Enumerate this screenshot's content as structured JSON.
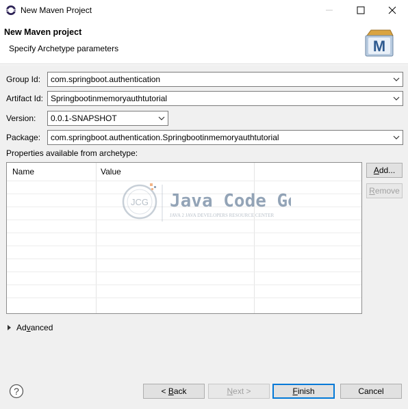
{
  "window": {
    "title": "New Maven Project"
  },
  "header": {
    "title": "New Maven project",
    "subtitle": "Specify Archetype parameters",
    "logo_letter": "M"
  },
  "form": {
    "group_id": {
      "label": "Group Id:",
      "value": "com.springboot.authentication"
    },
    "artifact_id": {
      "label": "Artifact Id:",
      "value": "Springbootinmemoryauthtutorial"
    },
    "version": {
      "label": "Version:",
      "value": "0.0.1-SNAPSHOT"
    },
    "package": {
      "label": "Package:",
      "value": "com.springboot.authentication.Springbootinmemoryauthtutorial"
    }
  },
  "properties": {
    "label": "Properties available from archetype:",
    "columns": [
      "Name",
      "Value"
    ],
    "rows": []
  },
  "side_buttons": {
    "add": {
      "label": "Add...",
      "mnemonic": "A",
      "rest": "dd..."
    },
    "remove": {
      "label": "Remove",
      "mnemonic": "R",
      "rest": "emove"
    }
  },
  "advanced": {
    "label": "Advanced",
    "mnemonic": "v",
    "pre": "Ad",
    "rest": "anced"
  },
  "footer": {
    "back": {
      "pre": "< ",
      "mnemonic": "B",
      "rest": "ack"
    },
    "next": {
      "pre": "",
      "mnemonic": "N",
      "rest": "ext >"
    },
    "finish": {
      "pre": "",
      "mnemonic": "F",
      "rest": "inish"
    },
    "cancel": {
      "label": "Cancel"
    }
  },
  "watermark": {
    "badge": "JCG",
    "name": "Java Code Geeks",
    "tagline": "JAVA 2 JAVA DEVELOPERS RESOURCE CENTER"
  },
  "colors": {
    "accent": "#0078d7",
    "dialog_bg": "#f0f0f0",
    "watermark_orange": "#e8792a",
    "watermark_blue": "#3b5a7e"
  }
}
